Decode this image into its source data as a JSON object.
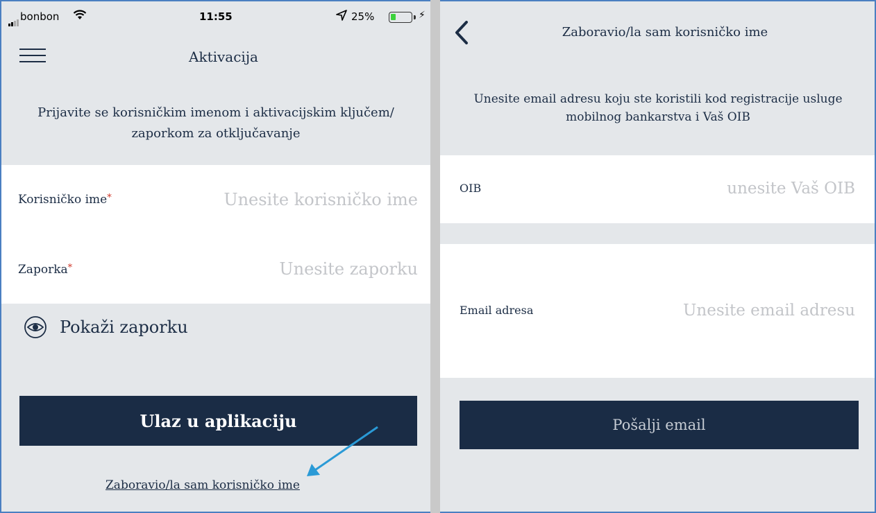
{
  "status_bar": {
    "carrier": "bonbon",
    "time": "11:55",
    "battery_percent": "25%",
    "battery_level": 0.25
  },
  "activation_screen": {
    "title": "Aktivacija",
    "intro": "Prijavite se korisničkim imenom i aktivacijskim ključem/ zaporkom za otključavanje",
    "username": {
      "label": "Korisničko ime",
      "required_mark": "*",
      "placeholder": "Unesite korisničko ime"
    },
    "password": {
      "label": "Zaporka",
      "required_mark": "*",
      "placeholder": "Unesite zaporku"
    },
    "show_password_label": "Pokaži zaporku",
    "login_button": "Ulaz u aplikaciju",
    "forgot_username_link": "Zaboravio/la sam korisničko ime"
  },
  "forgot_screen": {
    "title": "Zaboravio/la sam korisničko ime",
    "intro": "Unesite email adresu koju ste koristili kod registracije usluge mobilnog bankarstva i Vaš OIB",
    "oib": {
      "label": "OIB",
      "placeholder": "unesite Vaš OIB"
    },
    "email": {
      "label": "Email adresa",
      "placeholder": "Unesite email adresu"
    },
    "send_button": "Pošalji email"
  },
  "colors": {
    "primary": "#1a2c45",
    "background": "#e4e7ea",
    "card": "#ffffff",
    "required": "#d0392b",
    "annotation_arrow": "#2a9ad6",
    "placeholder": "#c3c5c9"
  },
  "icons": {
    "menu": "hamburger-menu-icon",
    "show_password": "eye-icon",
    "back": "chevron-left-icon",
    "wifi": "wifi-icon",
    "location": "location-arrow-icon",
    "battery": "battery-icon",
    "charging": "charging-bolt-icon"
  }
}
